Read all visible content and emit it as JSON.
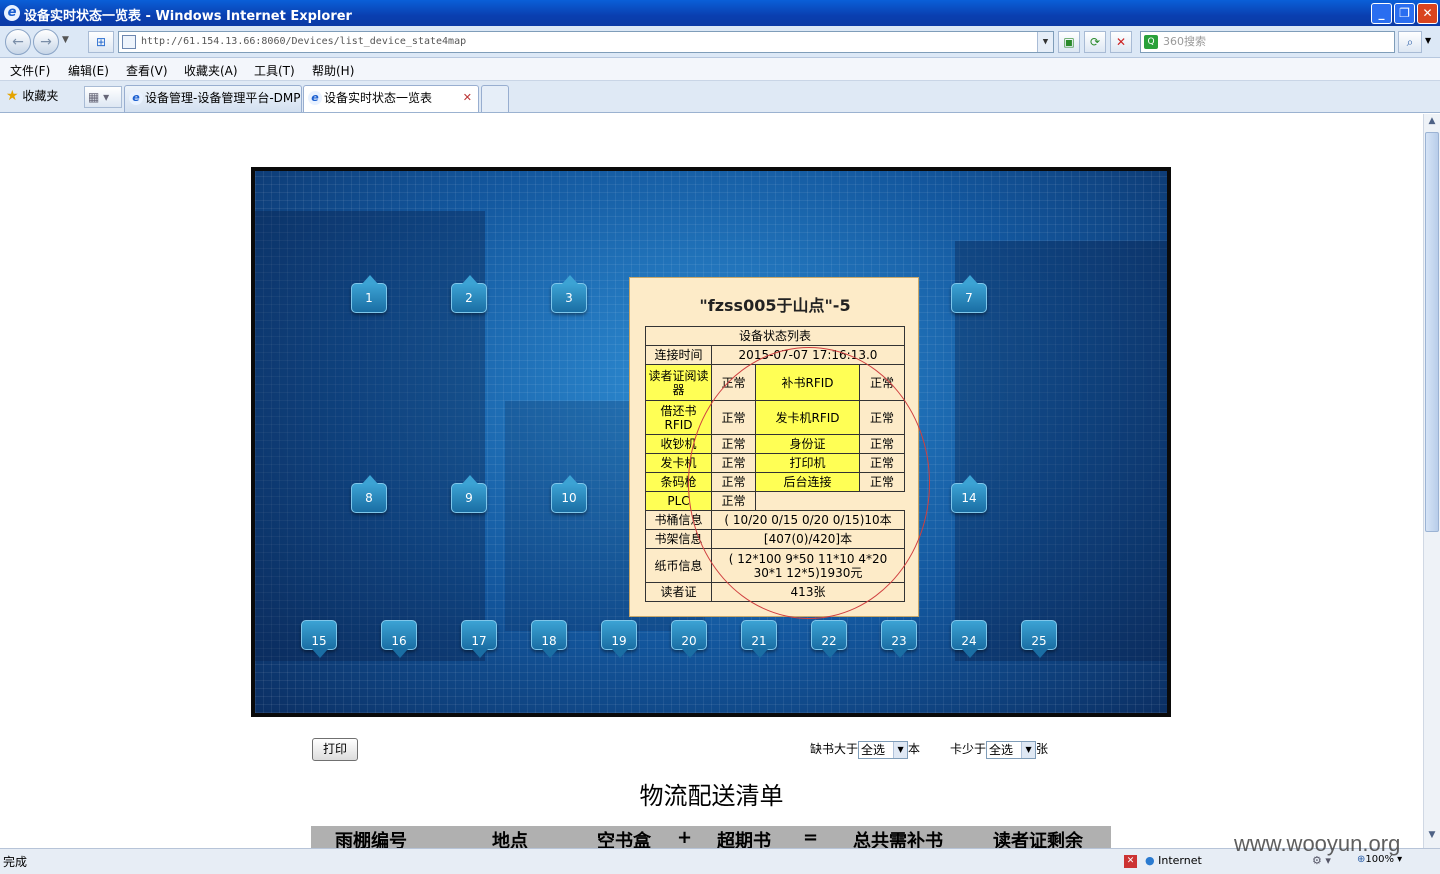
{
  "window": {
    "title": "设备实时状态一览表 - Windows Internet Explorer"
  },
  "address": {
    "url": "http://61.154.13.66:8060/Devices/list_device_state4map",
    "search_placeholder": "360搜索"
  },
  "menu": [
    "文件(F)",
    "编辑(E)",
    "查看(V)",
    "收藏夹(A)",
    "工具(T)",
    "帮助(H)"
  ],
  "favorites": {
    "label": "收藏夹"
  },
  "tabs": [
    {
      "label": "设备管理-设备管理平台-DMP",
      "active": false
    },
    {
      "label": "设备实时状态一览表",
      "active": true
    }
  ],
  "map": {
    "pins_top": [
      "1",
      "2",
      "3",
      "7"
    ],
    "pins_mid": [
      "8",
      "9",
      "10",
      "14"
    ],
    "pins_bottom": [
      "15",
      "16",
      "17",
      "18",
      "19",
      "20",
      "21",
      "22",
      "23",
      "24",
      "25"
    ]
  },
  "popup": {
    "title": "\"fzss005于山点\"-5",
    "header": "设备状态列表",
    "connect_label": "连接时间",
    "connect_value": "2015-07-07 17:16:13.0",
    "devices": [
      {
        "l1": "读者证阅读器",
        "s1": "正常",
        "l2": "补书RFID",
        "s2": "正常"
      },
      {
        "l1": "借还书RFID",
        "s1": "正常",
        "l2": "发卡机RFID",
        "s2": "正常"
      },
      {
        "l1": "收钞机",
        "s1": "正常",
        "l2": "身份证",
        "s2": "正常"
      },
      {
        "l1": "发卡机",
        "s1": "正常",
        "l2": "打印机",
        "s2": "正常"
      },
      {
        "l1": "条码枪",
        "s1": "正常",
        "l2": "后台连接",
        "s2": "正常"
      }
    ],
    "plc_label": "PLC",
    "plc_status": "正常",
    "info": [
      {
        "label": "书桶信息",
        "value": "( 10/20 0/15 0/20 0/15)10本"
      },
      {
        "label": "书架信息",
        "value": "[407(0)/420]本"
      },
      {
        "label": "纸币信息",
        "value": "( 12*100 9*50 11*10 4*20 30*1 12*5)1930元"
      },
      {
        "label": "读者证",
        "value": "413张"
      }
    ]
  },
  "controls": {
    "print_label": "打印",
    "filter1_label": "缺书大于",
    "filter1_value": "全选",
    "filter1_unit": "本",
    "filter2_label": "卡少于",
    "filter2_value": "全选",
    "filter2_unit": "张"
  },
  "list": {
    "title": "物流配送清单",
    "headers": [
      "雨棚编号",
      "地点",
      "空书盒",
      "+",
      "超期书",
      "=",
      "总共需补书",
      "读者证剩余"
    ]
  },
  "status": {
    "done": "完成",
    "zone": "Internet",
    "zoom": "100%"
  },
  "watermark": "www.wooyun.org"
}
